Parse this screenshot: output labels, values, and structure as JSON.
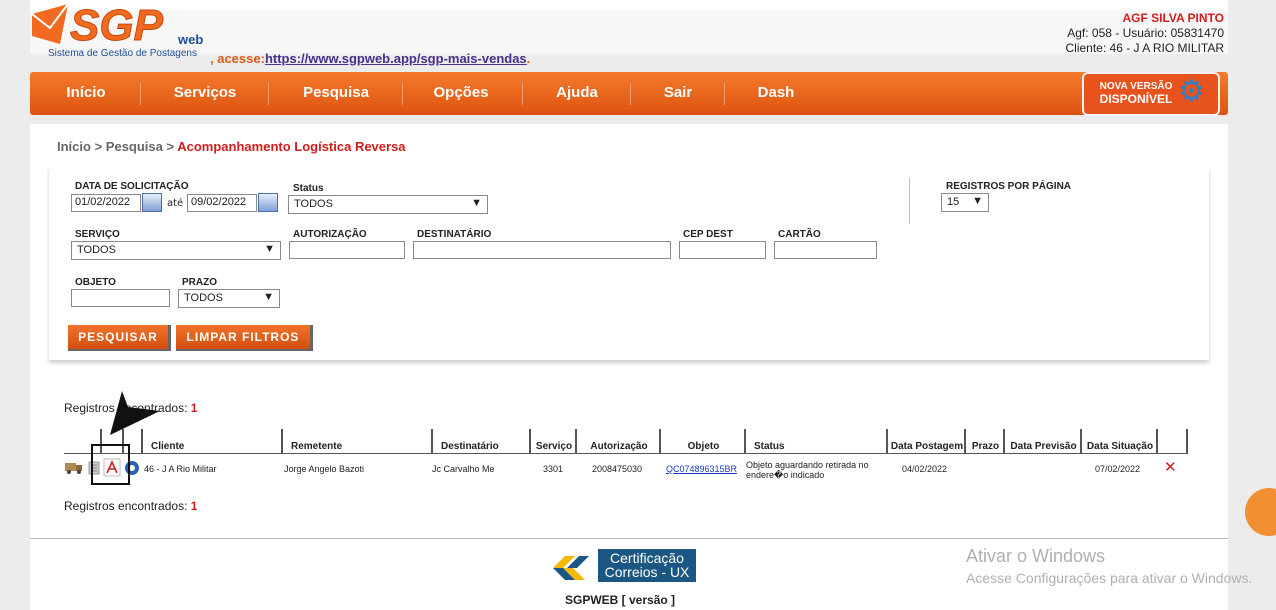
{
  "header": {
    "logo_text": "SGP",
    "logo_web": "web",
    "logo_sub": "Sistema de Gestão de Postagens",
    "promo_prefix": ", acesse:",
    "promo_link": "https://www.sgpweb.app/sgp-mais-vendas",
    "promo_suffix": ".",
    "agency": "AGF SILVA PINTO",
    "user_line": "Agf: 058 - Usuário: 05831470",
    "client_line": "Cliente: 46 - J A RIO MILITAR"
  },
  "nav": {
    "items": [
      "Início",
      "Serviços",
      "Pesquisa",
      "Opções",
      "Ajuda",
      "Sair",
      "Dash"
    ],
    "new_version_line1": "NOVA VERSÃO",
    "new_version_line2": "DISPONÍVEL"
  },
  "breadcrumb": {
    "home": "Início",
    "sep": ">",
    "section": "Pesquisa",
    "current": "Acompanhamento Logística Reversa"
  },
  "filters": {
    "date_label": "DATA DE SOLICITAÇÃO",
    "date_from": "01/02/2022",
    "date_to_label": "até",
    "date_to": "09/02/2022",
    "status_label": "Status",
    "status_value": "TODOS",
    "per_page_label": "REGISTROS POR PÁGINA",
    "per_page_value": "15",
    "service_label": "SERVIÇO",
    "service_value": "TODOS",
    "auth_label": "AUTORIZAÇÃO",
    "auth_value": "",
    "recipient_label": "DESTINATÁRIO",
    "recipient_value": "",
    "cep_label": "CEP DEST",
    "cep_value": "",
    "card_label": "CARTÃO",
    "card_value": "",
    "object_label": "OBJETO",
    "object_value": "",
    "deadline_label": "PRAZO",
    "deadline_value": "TODOS",
    "search_button": "PESQUISAR",
    "clear_button": "LIMPAR FILTROS"
  },
  "results": {
    "found_label": "Registros encontrados:",
    "found_count": "1",
    "columns": [
      "Cliente",
      "Remetente",
      "Destinatário",
      "Serviço",
      "Autorização",
      "Objeto",
      "Status",
      "Data Postagem",
      "Prazo",
      "Data Previsão",
      "Data Situação"
    ],
    "rows": [
      {
        "cliente": "46 - J A Rio Militar",
        "remetente": "Jorge Angelo Bazoti",
        "destinatario": "Jc Carvalho Me",
        "servico": "3301",
        "autorizacao": "2008475030",
        "objeto": "QC074896315BR",
        "status": "Objeto aguardando retirada no endere�o indicado",
        "data_postagem": "04/02/2022",
        "prazo": "",
        "data_previsao": "",
        "data_situacao": "07/02/2022"
      }
    ]
  },
  "footer": {
    "cert_line1": "Certificação",
    "cert_line2": "Correios - UX",
    "version": "SGPWEB [ versão ]",
    "windows_title": "Ativar o Windows",
    "windows_sub": "Acesse Configurações para ativar o Windows."
  },
  "colors": {
    "nav_orange": "#e8621c",
    "accent_red": "#d01d1d",
    "link_blue": "#1a3dc4"
  }
}
